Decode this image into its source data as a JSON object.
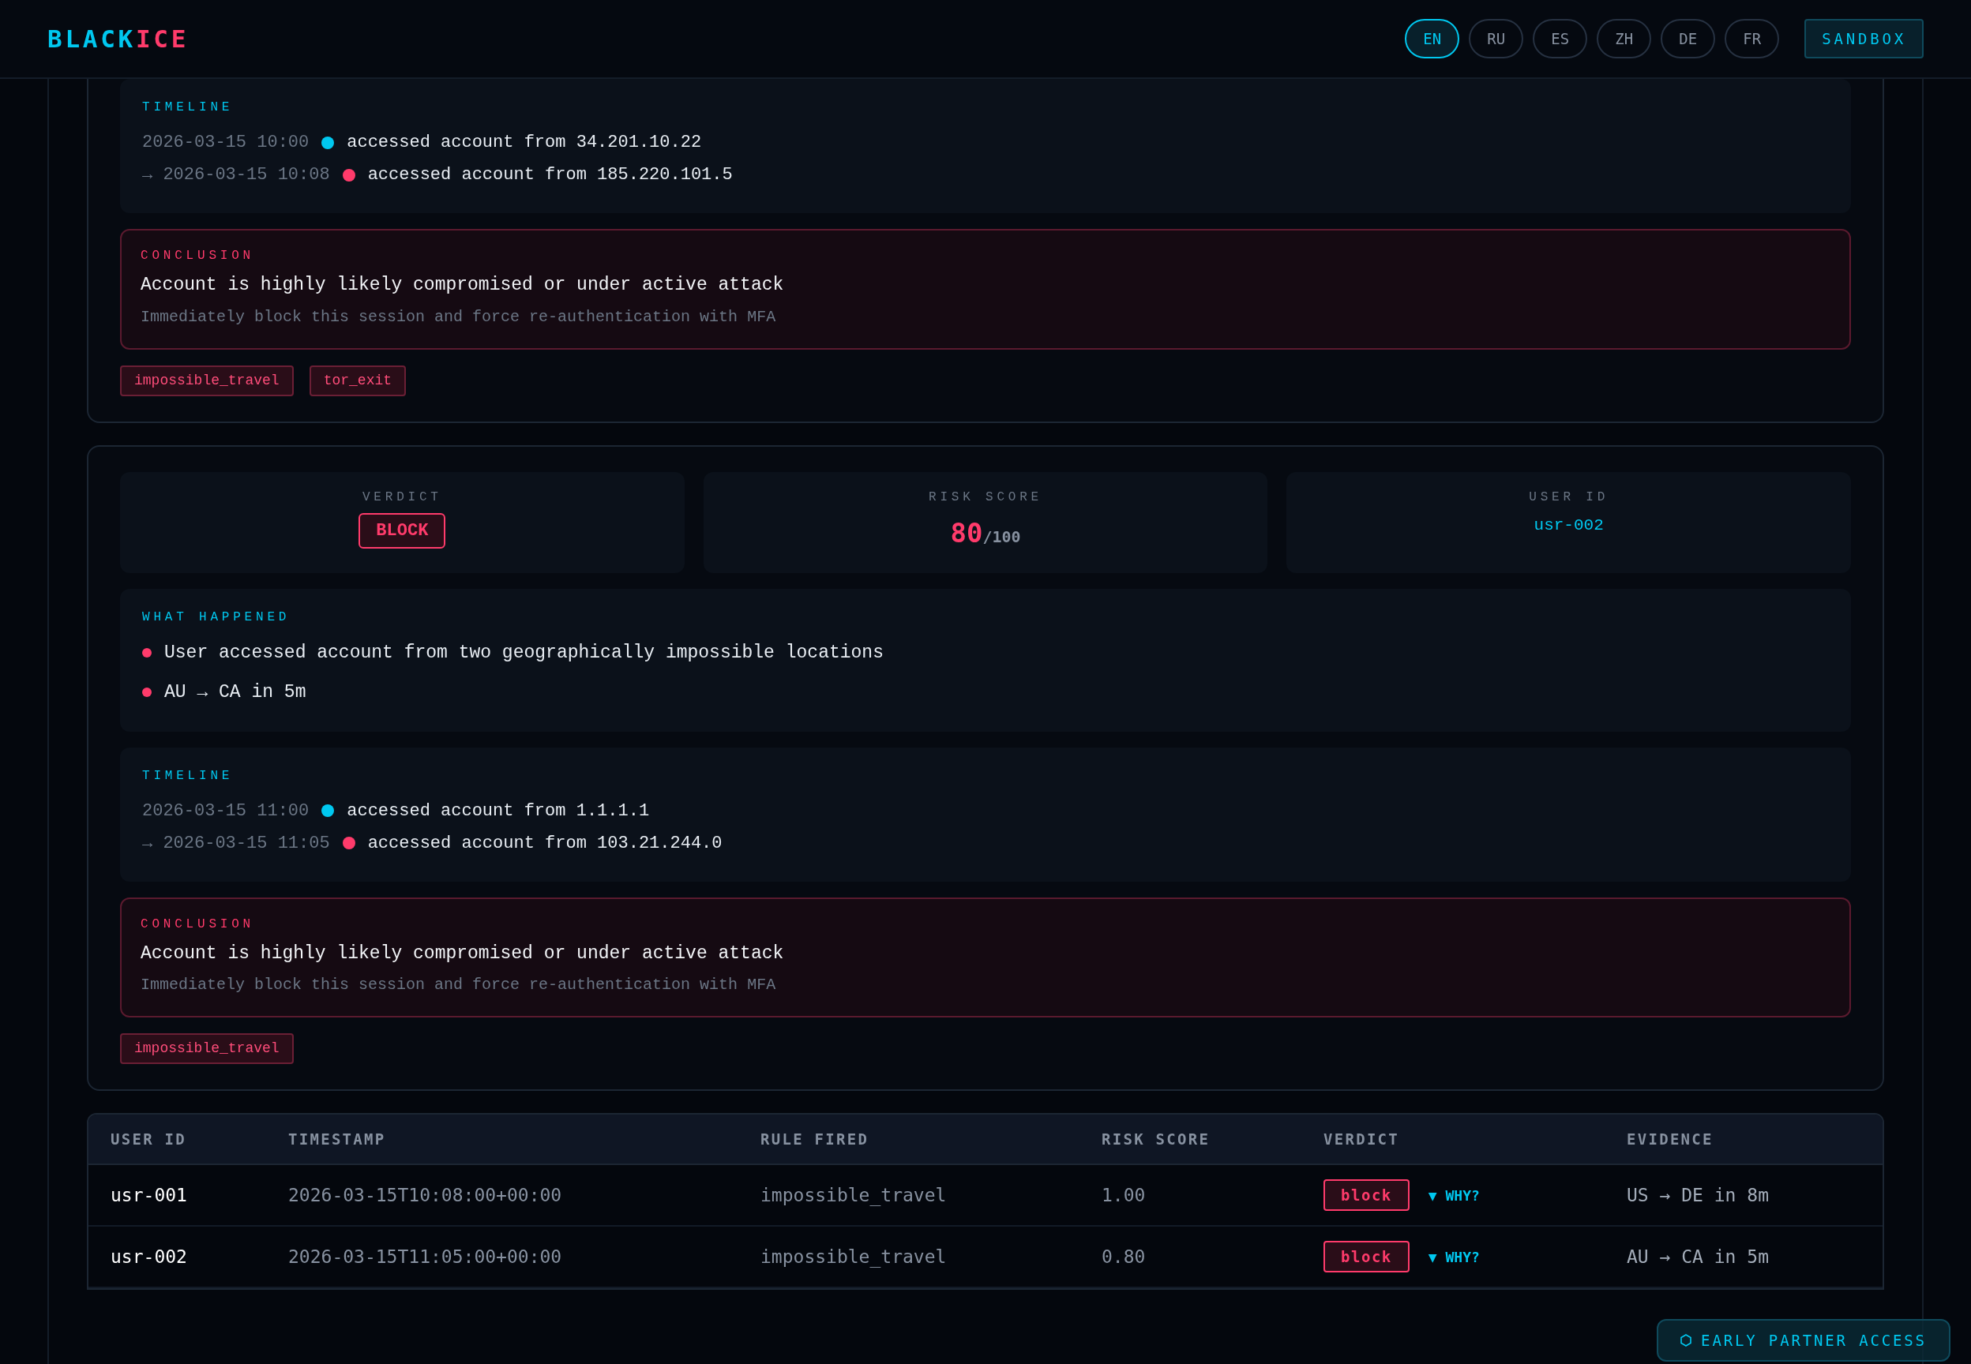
{
  "header": {
    "logo": {
      "first": "BLACK",
      "second": "ICE"
    },
    "languages": [
      {
        "label": "EN",
        "selected": true
      },
      {
        "label": "RU",
        "selected": false
      },
      {
        "label": "ES",
        "selected": false
      },
      {
        "label": "ZH",
        "selected": false
      },
      {
        "label": "DE",
        "selected": false
      },
      {
        "label": "FR",
        "selected": false
      }
    ],
    "sandbox_button": "SANDBOX"
  },
  "cases": [
    {
      "timeline": {
        "label": "TIMELINE",
        "events": [
          {
            "time": "2026-03-15 10:00",
            "color": "#00c8f0",
            "text": "accessed account from 34.201.10.22"
          },
          {
            "time": "→ 2026-03-15 10:08",
            "color": "#ff3b6b",
            "text": "accessed account from 185.220.101.5"
          }
        ]
      },
      "conclusion": {
        "label": "CONCLUSION",
        "title": "Account is highly likely compromised or under active attack",
        "advice": "Immediately block this session and force re-authentication with MFA"
      },
      "tags": [
        "impossible_travel",
        "tor_exit"
      ]
    },
    {
      "stats": {
        "verdict": {
          "label": "VERDICT",
          "value": "BLOCK"
        },
        "risk_score": {
          "label": "RISK SCORE",
          "value": "80",
          "max": "/100"
        },
        "user_id": {
          "label": "USER ID",
          "value": "usr-002"
        }
      },
      "what_happened": {
        "label": "WHAT HAPPENED",
        "items": [
          "User accessed account from two geographically impossible locations",
          "AU → CA in 5m"
        ]
      },
      "timeline": {
        "label": "TIMELINE",
        "events": [
          {
            "time": "2026-03-15 11:00",
            "color": "#00c8f0",
            "text": "accessed account from 1.1.1.1"
          },
          {
            "time": "→ 2026-03-15 11:05",
            "color": "#ff3b6b",
            "text": "accessed account from 103.21.244.0"
          }
        ]
      },
      "conclusion": {
        "label": "CONCLUSION",
        "title": "Account is highly likely compromised or under active attack",
        "advice": "Immediately block this session and force re-authentication with MFA"
      },
      "tags": [
        "impossible_travel"
      ]
    }
  ],
  "table": {
    "columns": [
      "USER ID",
      "TIMESTAMP",
      "RULE FIRED",
      "RISK SCORE",
      "VERDICT",
      "EVIDENCE"
    ],
    "rows": [
      {
        "user_id": "usr-001",
        "timestamp": "2026-03-15T10:08:00+00:00",
        "rule": "impossible_travel",
        "risk": "1.00",
        "verdict": "block",
        "why": "▼ WHY?",
        "evidence": "US → DE in 8m"
      },
      {
        "user_id": "usr-002",
        "timestamp": "2026-03-15T11:05:00+00:00",
        "rule": "impossible_travel",
        "risk": "0.80",
        "verdict": "block",
        "why": "▼ WHY?",
        "evidence": "AU → CA in 5m"
      }
    ]
  },
  "partner_badge": "EARLY PARTNER ACCESS"
}
